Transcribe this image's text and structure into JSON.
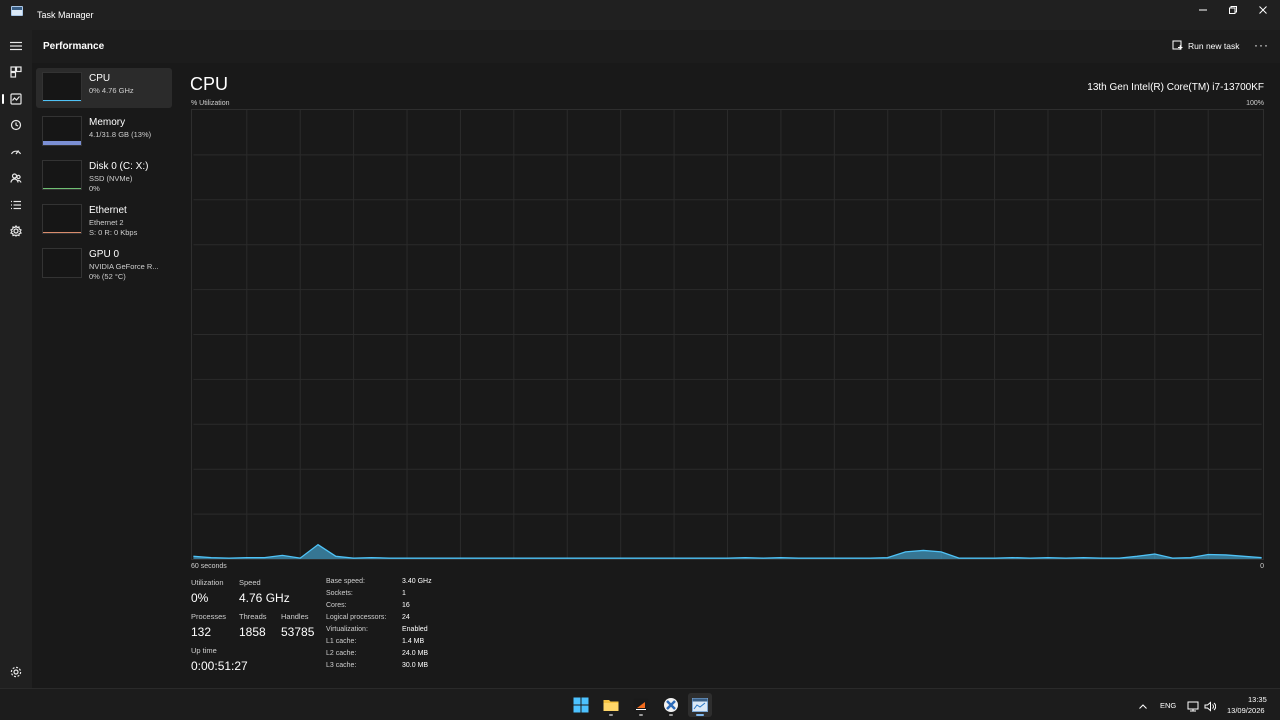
{
  "window": {
    "title": "Task Manager"
  },
  "header": {
    "page_title": "Performance",
    "run_new_task": "Run new task"
  },
  "resources": [
    {
      "name": "CPU",
      "line1": "0% 4.76 GHz",
      "line2": ""
    },
    {
      "name": "Memory",
      "line1": "4.1/31.8 GB (13%)",
      "line2": ""
    },
    {
      "name": "Disk 0 (C: X:)",
      "line1": "SSD (NVMe)",
      "line2": "0%"
    },
    {
      "name": "Ethernet",
      "line1": "Ethernet 2",
      "line2": "S: 0 R: 0 Kbps"
    },
    {
      "name": "GPU 0",
      "line1": "NVIDIA GeForce R...",
      "line2": "0% (52 °C)"
    }
  ],
  "main": {
    "title": "CPU",
    "model": "13th Gen Intel(R) Core(TM) i7-13700KF",
    "util_label": "% Utilization",
    "max_label": "100%",
    "axis_left": "60 seconds",
    "axis_right": "0"
  },
  "stats": {
    "utilization": {
      "label": "Utilization",
      "value": "0%"
    },
    "speed": {
      "label": "Speed",
      "value": "4.76 GHz"
    },
    "processes": {
      "label": "Processes",
      "value": "132"
    },
    "threads": {
      "label": "Threads",
      "value": "1858"
    },
    "handles": {
      "label": "Handles",
      "value": "53785"
    },
    "uptime": {
      "label": "Up time",
      "value": "0:00:51:27"
    }
  },
  "specs": [
    {
      "label": "Base speed:",
      "value": "3.40 GHz"
    },
    {
      "label": "Sockets:",
      "value": "1"
    },
    {
      "label": "Cores:",
      "value": "16"
    },
    {
      "label": "Logical processors:",
      "value": "24"
    },
    {
      "label": "Virtualization:",
      "value": "Enabled"
    },
    {
      "label": "L1 cache:",
      "value": "1.4 MB"
    },
    {
      "label": "L2 cache:",
      "value": "24.0 MB"
    },
    {
      "label": "L3 cache:",
      "value": "30.0 MB"
    }
  ],
  "chart_data": {
    "type": "area",
    "title": "CPU",
    "ylabel": "% Utilization",
    "ylim": [
      0,
      100
    ],
    "x_label_left": "60 seconds",
    "x_label_right": "0",
    "series": [
      {
        "values": [
          0.6,
          0.3,
          0.2,
          0.3,
          0.3,
          0.8,
          0.2,
          3.2,
          0.6,
          0.2,
          0.3,
          0.2,
          0.2,
          0.2,
          0.2,
          0.2,
          0.2,
          0.2,
          0.2,
          0.2,
          0.2,
          0.2,
          0.2,
          0.2,
          0.2,
          0.2,
          0.2,
          0.2,
          0.2,
          0.2,
          0.2,
          0.3,
          0.2,
          0.3,
          0.2,
          0.2,
          0.2,
          0.2,
          0.2,
          0.3,
          1.6,
          1.9,
          1.6,
          0.2,
          0.2,
          0.2,
          0.3,
          0.2,
          0.3,
          0.2,
          0.3,
          0.2,
          0.2,
          0.6,
          1.1,
          0.2,
          0.3,
          1.0,
          0.9,
          0.6,
          0.3
        ]
      }
    ],
    "color": "#4fc3f7"
  },
  "taskbar": {
    "lang": "ENG",
    "time": "13:35",
    "date": "13/09/2026"
  }
}
